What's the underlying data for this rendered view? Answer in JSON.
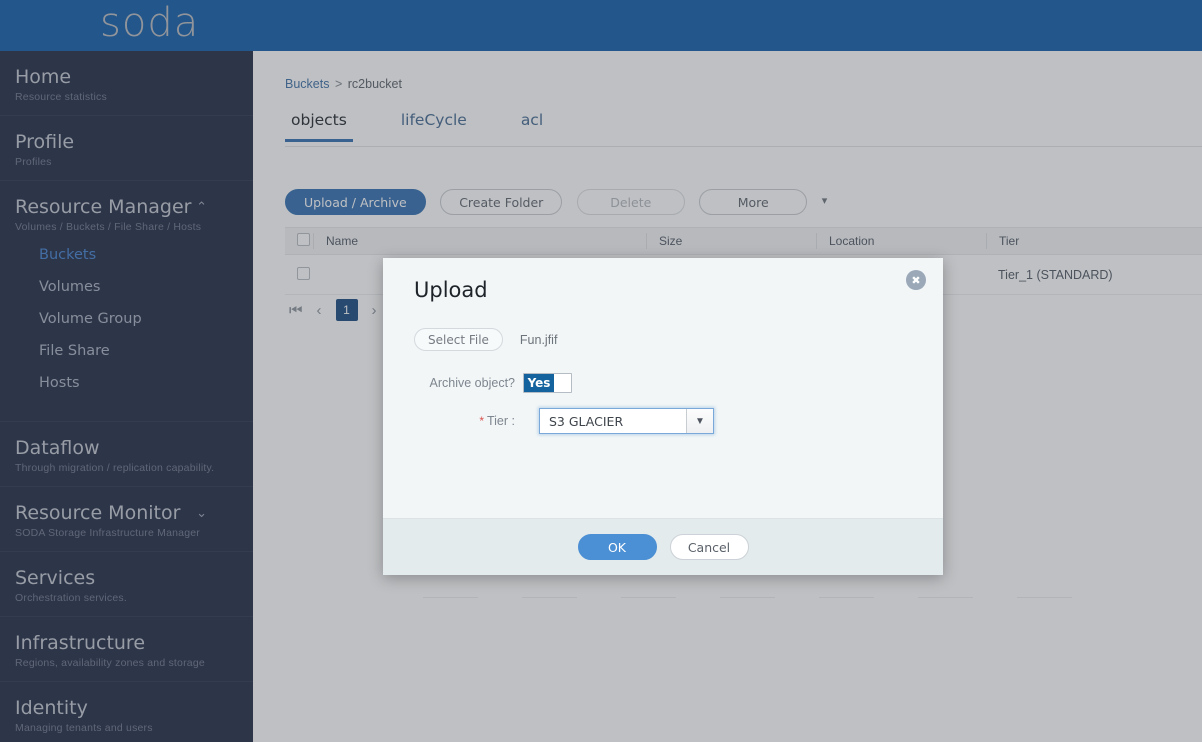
{
  "app": {
    "logo_text": "soda",
    "brand_color": "#0d5aa7",
    "accent_color": "#2f6db0",
    "sidebar_color": "#1d2640"
  },
  "sidebar": {
    "groups": [
      {
        "title": "Home",
        "sub": "Resource statistics",
        "chevron": "",
        "items": []
      },
      {
        "title": "Profile",
        "sub": "Profiles",
        "chevron": "",
        "items": []
      },
      {
        "title": "Resource Manager",
        "sub": "Volumes / Buckets / File Share / Hosts",
        "chevron": "⌃",
        "items": [
          {
            "label": "Buckets",
            "active": true
          },
          {
            "label": "Volumes",
            "active": false
          },
          {
            "label": "Volume Group",
            "active": false
          },
          {
            "label": "File Share",
            "active": false
          },
          {
            "label": "Hosts",
            "active": false
          }
        ]
      },
      {
        "title": "Dataflow",
        "sub": "Through migration / replication capability.",
        "chevron": "",
        "items": []
      },
      {
        "title": "Resource Monitor",
        "sub": "SODA Storage Infrastructure Manager",
        "chevron": "⌄",
        "items": []
      },
      {
        "title": "Services",
        "sub": "Orchestration services.",
        "chevron": "",
        "items": []
      },
      {
        "title": "Infrastructure",
        "sub": "Regions, availability zones and storage",
        "chevron": "",
        "items": []
      },
      {
        "title": "Identity",
        "sub": "Managing tenants and users",
        "chevron": "",
        "items": []
      }
    ]
  },
  "breadcrumb": {
    "root": "Buckets",
    "separator": ">",
    "current": "rc2bucket"
  },
  "tabs": [
    {
      "label": "objects",
      "active": true
    },
    {
      "label": "lifeCycle",
      "active": false
    },
    {
      "label": "acl",
      "active": false
    }
  ],
  "toolbar": {
    "upload_label": "Upload / Archive",
    "create_folder_label": "Create Folder",
    "delete_label": "Delete",
    "more_label": "More",
    "more_caret": "▾"
  },
  "table": {
    "headers": [
      "",
      "Name",
      "Size",
      "Location",
      "Tier"
    ],
    "rows": [
      {
        "name": "",
        "size": "",
        "location": "",
        "tier": "Tier_1 (STANDARD)"
      }
    ]
  },
  "pagination": {
    "first_icon": "⏮",
    "prev_icon": "‹",
    "current_page": "1",
    "next_icon": "›"
  },
  "modal": {
    "title": "Upload",
    "close_icon": "✖",
    "select_file_label": "Select File",
    "file_name": "Fun.jfif",
    "archive_label": "Archive object?",
    "archive_toggle_value": "Yes",
    "tier_label": "Tier :",
    "tier_required_mark": "*",
    "tier_value": "S3 GLACIER",
    "tier_caret": "▼",
    "ok_label": "OK",
    "cancel_label": "Cancel"
  }
}
